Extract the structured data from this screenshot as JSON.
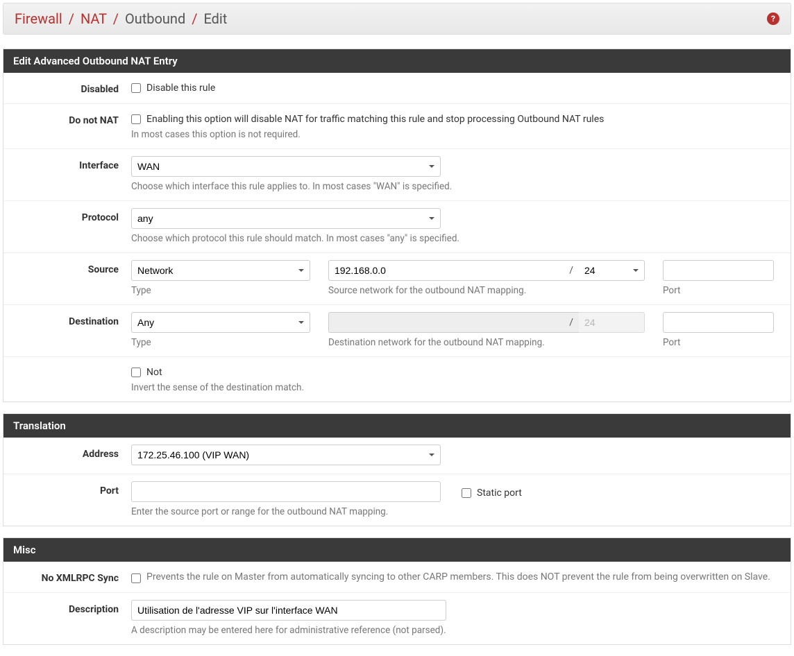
{
  "breadcrumb": {
    "items": [
      "Firewall",
      "NAT",
      "Outbound",
      "Edit"
    ]
  },
  "panels": {
    "edit": {
      "title": "Edit Advanced Outbound NAT Entry"
    },
    "translation": {
      "title": "Translation"
    },
    "misc": {
      "title": "Misc"
    }
  },
  "labels": {
    "disabled": "Disabled",
    "do_not_nat": "Do not NAT",
    "interface": "Interface",
    "protocol": "Protocol",
    "source": "Source",
    "destination": "Destination",
    "address": "Address",
    "port": "Port",
    "no_xmlrpc": "No XMLRPC Sync",
    "description": "Description"
  },
  "fields": {
    "disabled": {
      "checkbox_label": "Disable this rule"
    },
    "do_not_nat": {
      "checkbox_label": "Enabling this option will disable NAT for traffic matching this rule and stop processing Outbound NAT rules",
      "help": "In most cases this option is not required."
    },
    "interface": {
      "value": "WAN",
      "help": "Choose which interface this rule applies to. In most cases \"WAN\" is specified."
    },
    "protocol": {
      "value": "any",
      "help": "Choose which protocol this rule should match. In most cases \"any\" is specified."
    },
    "source": {
      "type": "Network",
      "type_label": "Type",
      "addr": "192.168.0.0",
      "mask": "24",
      "addr_help": "Source network for the outbound NAT mapping.",
      "port": "",
      "port_label": "Port"
    },
    "destination": {
      "type": "Any",
      "type_label": "Type",
      "addr": "",
      "mask": "24",
      "addr_help": "Destination network for the outbound NAT mapping.",
      "port": "",
      "port_label": "Port",
      "not_label": "Not",
      "not_help": "Invert the sense of the destination match."
    },
    "translation": {
      "address": "172.25.46.100 (VIP WAN)",
      "port": "",
      "static_port_label": "Static port",
      "port_help": "Enter the source port or range for the outbound NAT mapping."
    },
    "no_xmlrpc": {
      "text": "Prevents the rule on Master from automatically syncing to other CARP members. This does NOT prevent the rule from being overwritten on Slave."
    },
    "description": {
      "value": "Utilisation de l'adresse VIP sur l'interface WAN",
      "help": "A description may be entered here for administrative reference (not parsed)."
    }
  }
}
